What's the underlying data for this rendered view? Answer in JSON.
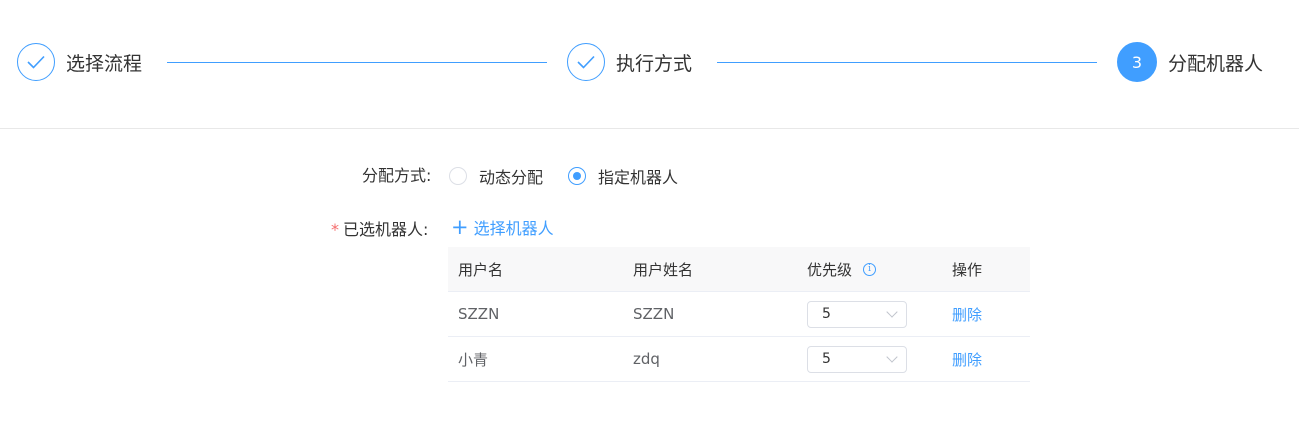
{
  "steps": {
    "items": [
      {
        "title": "选择流程",
        "state": "done",
        "icon": "check-icon"
      },
      {
        "title": "执行方式",
        "state": "done",
        "icon": "check-icon"
      },
      {
        "title": "分配机器人",
        "state": "active",
        "number": "3"
      }
    ]
  },
  "form": {
    "allocation_label": "分配方式:",
    "allocation_options": [
      {
        "label": "动态分配",
        "checked": false
      },
      {
        "label": "指定机器人",
        "checked": true
      }
    ],
    "selected_robots_required_mark": "*",
    "selected_robots_label": "已选机器人:",
    "add_robot_icon": "plus-icon",
    "add_robot_label": "选择机器人"
  },
  "table": {
    "headers": [
      "用户名",
      "用户姓名",
      "优先级",
      "操作"
    ],
    "priority_help_icon": "info-icon",
    "rows": [
      {
        "username": "SZZN",
        "full_name": "SZZN",
        "priority": "5",
        "action": "删除"
      },
      {
        "username": "小青",
        "full_name": "zdq",
        "priority": "5",
        "action": "删除"
      }
    ]
  },
  "colors": {
    "accent": "#409eff",
    "required": "#f56c6c",
    "divider": "#e8e8e8"
  }
}
